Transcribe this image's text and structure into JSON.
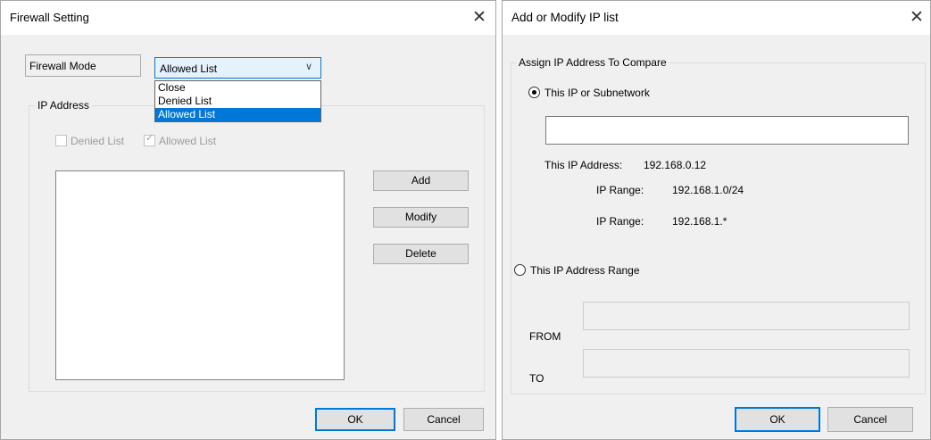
{
  "firewall_dialog": {
    "title": "Firewall Setting",
    "mode_label": "Firewall Mode",
    "mode_selected": "Allowed List",
    "mode_options": [
      "Close",
      "Denied List",
      "Allowed List"
    ],
    "mode_highlighted": "Allowed List",
    "ip_group_label": "IP Address",
    "checkbox_denied": "Denied List",
    "checkbox_allowed": "Allowed List",
    "checkbox_allowed_checked": true,
    "add_button": "Add",
    "modify_button": "Modify",
    "delete_button": "Delete",
    "ok_button": "OK",
    "cancel_button": "Cancel"
  },
  "ip_dialog": {
    "title": "Add or Modify IP list",
    "group_label": "Assign IP Address To Compare",
    "radio_single": "This IP or Subnetwork",
    "radio_single_selected": true,
    "ip_input_value": "",
    "example_ip_label": "This IP Address:",
    "example_ip_value": "192.168.0.12",
    "example_range1_label": "IP Range:",
    "example_range1_value": "192.168.1.0/24",
    "example_range2_label": "IP Range:",
    "example_range2_value": "192.168.1.*",
    "radio_range": "This IP Address Range",
    "from_label": "FROM",
    "to_label": "TO",
    "from_value": "",
    "to_value": "",
    "ok_button": "OK",
    "cancel_button": "Cancel"
  },
  "colors": {
    "accent": "#0078d7",
    "dialog_bg": "#f0f0f0",
    "titlebar_bg": "#ffffff"
  }
}
